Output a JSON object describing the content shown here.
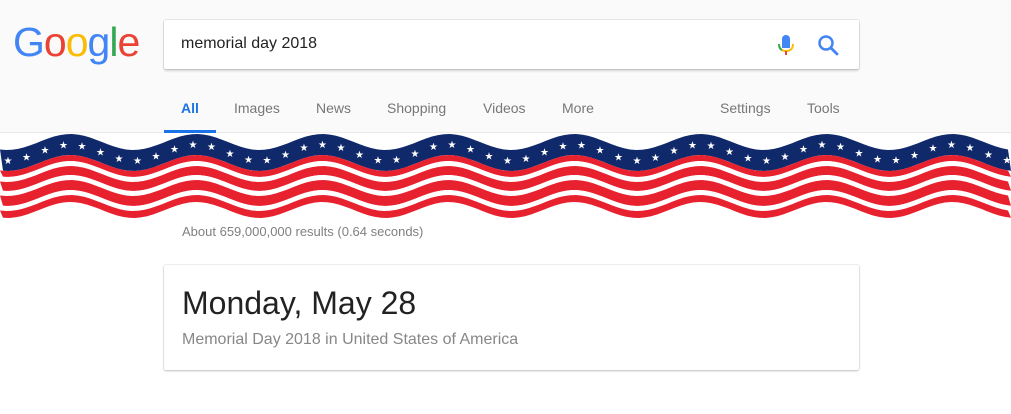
{
  "logo": {
    "letters": [
      {
        "char": "G",
        "color": "#4285F4"
      },
      {
        "char": "o",
        "color": "#EA4335"
      },
      {
        "char": "o",
        "color": "#FBBC05"
      },
      {
        "char": "g",
        "color": "#4285F4"
      },
      {
        "char": "l",
        "color": "#34A853"
      },
      {
        "char": "e",
        "color": "#EA4335"
      }
    ]
  },
  "search": {
    "value": "memorial day 2018",
    "accent": "#4285F4"
  },
  "tabs": [
    {
      "label": "All",
      "active": true
    },
    {
      "label": "Images",
      "active": false
    },
    {
      "label": "News",
      "active": false
    },
    {
      "label": "Shopping",
      "active": false
    },
    {
      "label": "Videos",
      "active": false
    },
    {
      "label": "More",
      "active": false
    },
    {
      "label": "Settings",
      "active": false
    },
    {
      "label": "Tools",
      "active": false
    }
  ],
  "banner": {
    "colors": {
      "blue": "#10296b",
      "red": "#e8212f",
      "white": "#ffffff"
    }
  },
  "results": {
    "stats": "About 659,000,000 results (0.64 seconds)"
  },
  "answer": {
    "title": "Monday, May 28",
    "subtitle": "Memorial Day 2018 in United States of America"
  }
}
